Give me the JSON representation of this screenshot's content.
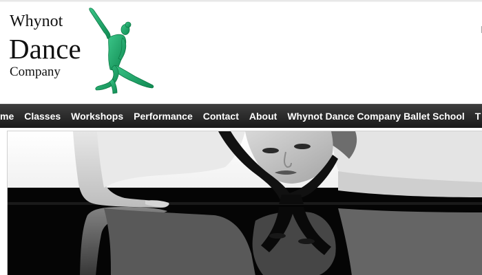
{
  "logo": {
    "line1": "Whynot",
    "line2": "Dance",
    "line3": "Company",
    "figure_icon": "green-dancer-figure",
    "figure_color": "#1fa868"
  },
  "header": {
    "right_text": "F"
  },
  "nav": {
    "items": [
      {
        "label": "me"
      },
      {
        "label": "Classes"
      },
      {
        "label": "Workshops"
      },
      {
        "label": "Performance"
      },
      {
        "label": "Contact"
      },
      {
        "label": "About"
      },
      {
        "label": "Whynot Dance Company Ballet School"
      },
      {
        "label": "T"
      }
    ]
  },
  "hero": {
    "image": "black-and-white-dancer-reflection"
  }
}
